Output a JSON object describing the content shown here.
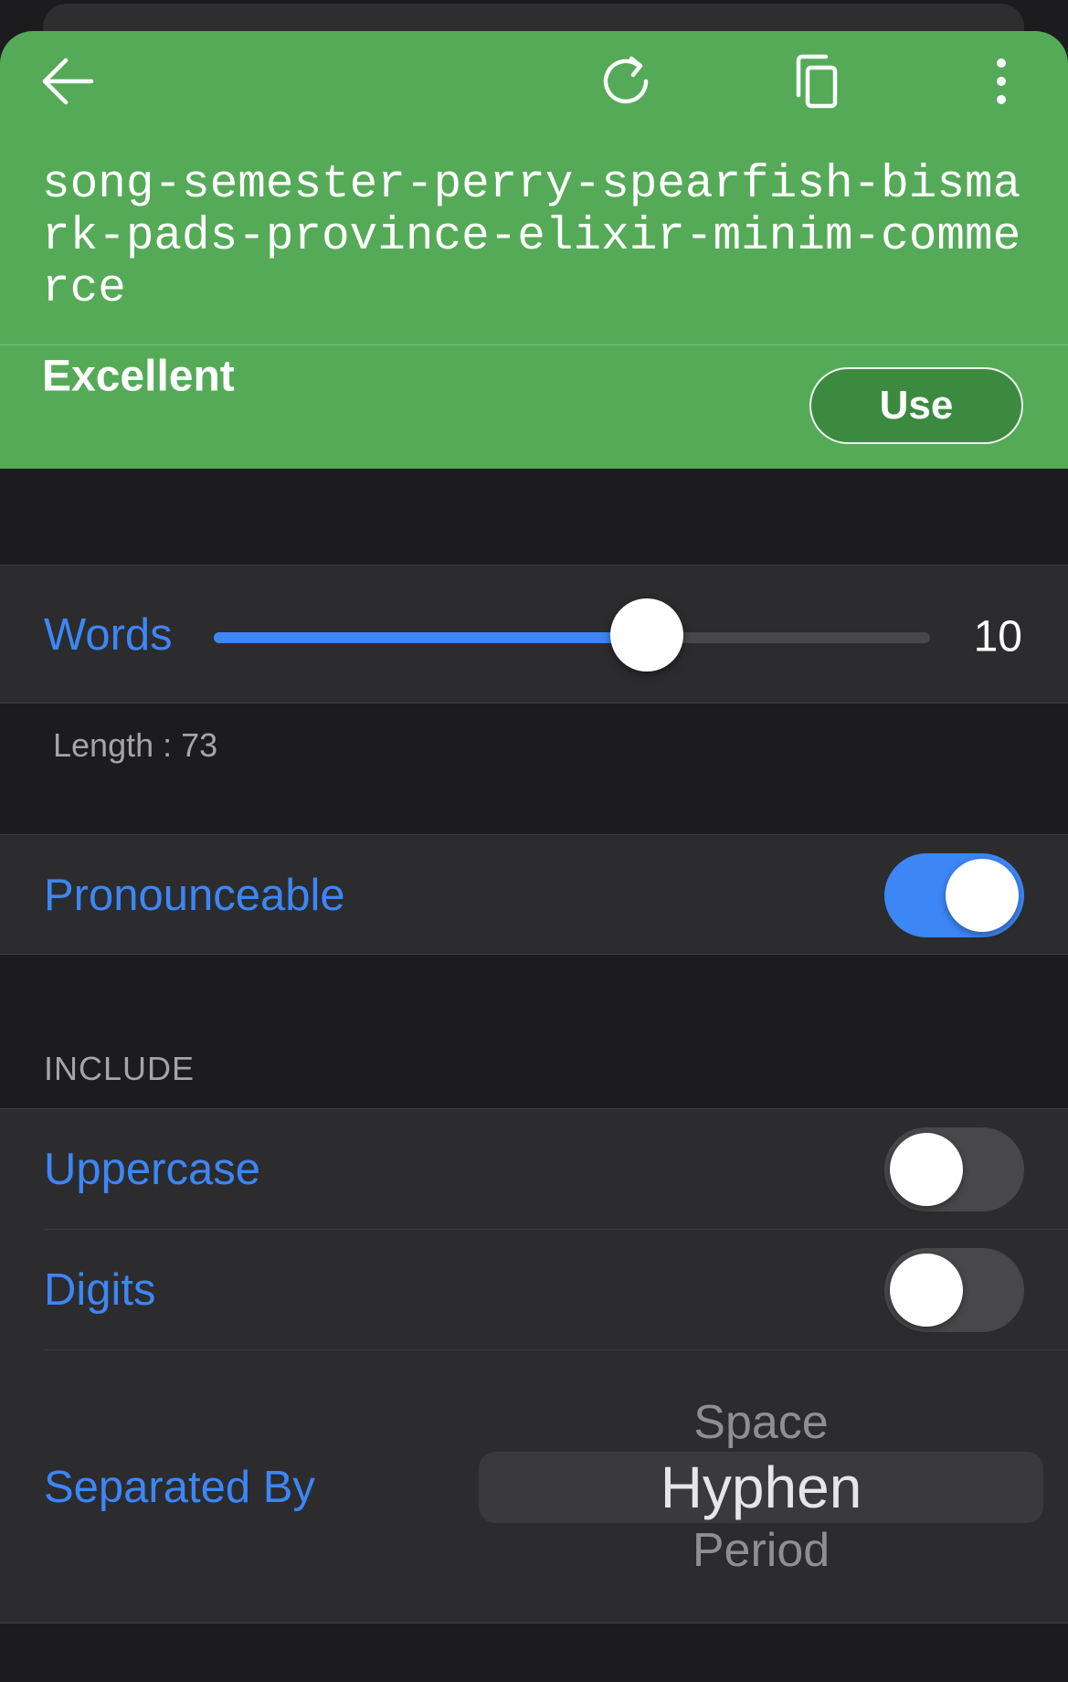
{
  "toolbar": {
    "back_icon": "arrow-left-icon",
    "refresh_icon": "refresh-icon",
    "copy_icon": "copy-icon",
    "more_icon": "more-vertical-icon"
  },
  "header": {
    "password": "song-semester-perry-spearfish-bismark-pads-province-elixir-minim-commerce",
    "strength_label": "Excellent",
    "use_label": "Use",
    "background_color": "#55aa58"
  },
  "words": {
    "label": "Words",
    "value": "10",
    "slider_fraction": 0.605
  },
  "length_text": "Length : 73",
  "pronounceable": {
    "label": "Pronounceable",
    "on": true
  },
  "include": {
    "header": "INCLUDE",
    "uppercase": {
      "label": "Uppercase",
      "on": false
    },
    "digits": {
      "label": "Digits",
      "on": false
    }
  },
  "separator": {
    "label": "Separated By",
    "options": [
      "Space",
      "Hyphen",
      "Period"
    ],
    "selected": "Hyphen"
  },
  "colors": {
    "accent": "#3d86f5",
    "background": "#1c1c1e",
    "cell": "#2c2c2e"
  }
}
